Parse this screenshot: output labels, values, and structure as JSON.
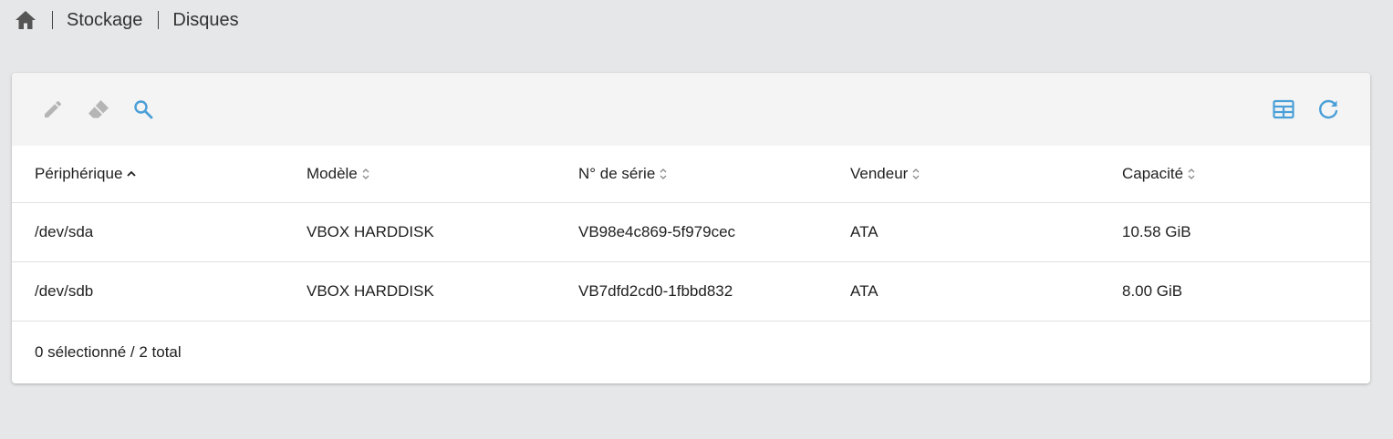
{
  "breadcrumb": {
    "home_icon": "home-icon",
    "items": [
      {
        "label": "Stockage"
      },
      {
        "label": "Disques"
      }
    ]
  },
  "toolbar": {
    "left_icons": [
      "pencil-icon",
      "eraser-icon",
      "search-icon"
    ],
    "right_icons": [
      "table-columns-icon",
      "refresh-icon"
    ],
    "colors": {
      "disabled": "#b5b5b5",
      "accent": "#4a9fd8"
    }
  },
  "table": {
    "columns": [
      {
        "label": "Périphérique",
        "sort": "ascending"
      },
      {
        "label": "Modèle",
        "sort": "none"
      },
      {
        "label": "N° de série",
        "sort": "none"
      },
      {
        "label": "Vendeur",
        "sort": "none"
      },
      {
        "label": "Capacité",
        "sort": "none"
      }
    ],
    "rows": [
      {
        "device": "/dev/sda",
        "model": "VBOX HARDDISK",
        "serial": "VB98e4c869-5f979cec",
        "vendor": "ATA",
        "capacity": "10.58 GiB"
      },
      {
        "device": "/dev/sdb",
        "model": "VBOX HARDDISK",
        "serial": "VB7dfd2cd0-1fbbd832",
        "vendor": "ATA",
        "capacity": "8.00 GiB"
      }
    ]
  },
  "footer": {
    "selection_text": "0 sélectionné / 2 total"
  }
}
